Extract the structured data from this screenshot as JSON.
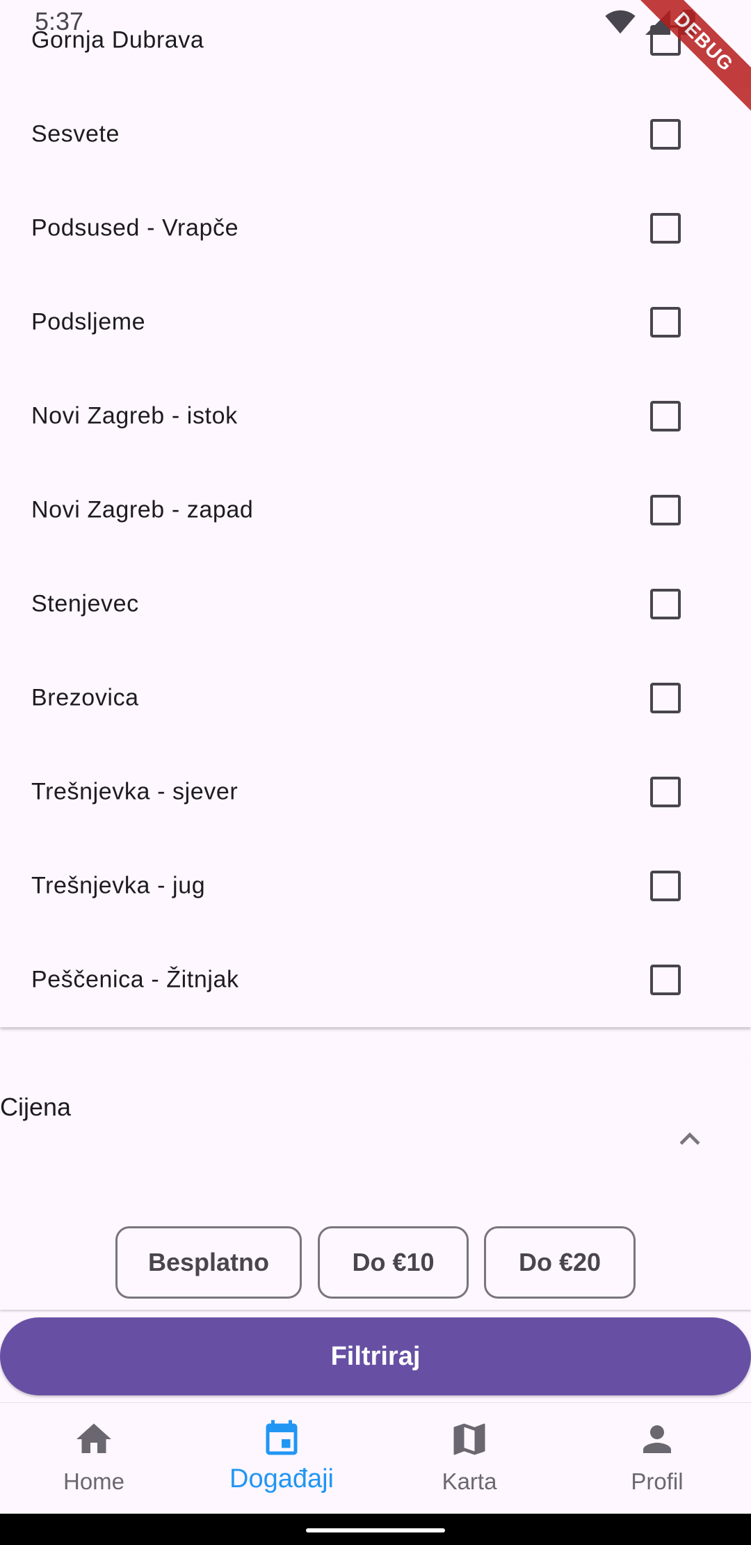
{
  "status_bar": {
    "time": "5:37",
    "debug_label": "DEBUG"
  },
  "districts": [
    {
      "label": "Gornja Dubrava",
      "checked": false
    },
    {
      "label": "Sesvete",
      "checked": false
    },
    {
      "label": "Podsused - Vrapče",
      "checked": false
    },
    {
      "label": "Podsljeme",
      "checked": false
    },
    {
      "label": "Novi Zagreb - istok",
      "checked": false
    },
    {
      "label": "Novi Zagreb - zapad",
      "checked": false
    },
    {
      "label": "Stenjevec",
      "checked": false
    },
    {
      "label": "Brezovica",
      "checked": false
    },
    {
      "label": "Trešnjevka - sjever",
      "checked": false
    },
    {
      "label": "Trešnjevka - jug",
      "checked": false
    },
    {
      "label": "Peščenica - Žitnjak",
      "checked": false
    }
  ],
  "price_section": {
    "title": "Cijena",
    "options": [
      "Besplatno",
      "Do €10",
      "Do €20"
    ]
  },
  "filter_button": {
    "label": "Filtriraj"
  },
  "bottom_nav": {
    "items": [
      {
        "label": "Home",
        "icon": "home-icon"
      },
      {
        "label": "Događaji",
        "icon": "calendar-icon"
      },
      {
        "label": "Karta",
        "icon": "map-icon"
      },
      {
        "label": "Profil",
        "icon": "person-icon"
      }
    ],
    "active": "Događaji"
  },
  "colors": {
    "primary": "#6750a4",
    "active_nav": "#2196f3",
    "background": "#fef7ff",
    "debug_banner": "#b71c1c"
  }
}
